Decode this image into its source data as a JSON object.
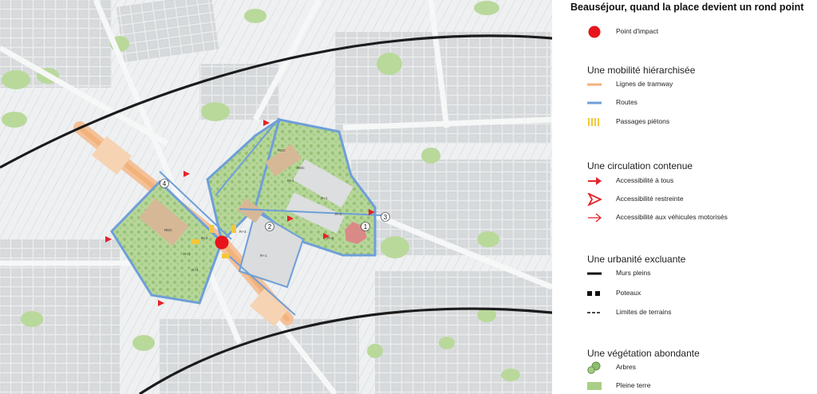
{
  "legend": {
    "title": "Beauséjour, quand la place devient un rond point",
    "impact_label": "Point d'impact",
    "sections": [
      {
        "heading": "Une mobilité hiérarchisée",
        "items": [
          {
            "label": "Lignes de tramway",
            "symbol": "tram-line-icon"
          },
          {
            "label": "Routes",
            "symbol": "road-line-icon"
          },
          {
            "label": "Passages piétons",
            "symbol": "crosswalk-icon"
          }
        ]
      },
      {
        "heading": "Une circulation contenue",
        "items": [
          {
            "label": "Accessibilité à tous",
            "symbol": "full-access-arrow-icon"
          },
          {
            "label": "Accessibilité restreinte",
            "symbol": "restricted-access-arrow-icon"
          },
          {
            "label": "Accessibilité aux véhicules motorisés",
            "symbol": "vehicle-access-arrow-icon"
          }
        ]
      },
      {
        "heading": "Une urbanité excluante",
        "items": [
          {
            "label": "Murs pleins",
            "symbol": "solid-wall-icon"
          },
          {
            "label": "Poteaux",
            "symbol": "posts-icon"
          },
          {
            "label": "Limites de terrains",
            "symbol": "property-limit-icon"
          }
        ]
      },
      {
        "heading": "Une végétation abondante",
        "items": [
          {
            "label": "Arbres",
            "symbol": "tree-icon"
          },
          {
            "label": "Pleine terre",
            "symbol": "open-ground-icon"
          }
        ]
      }
    ]
  },
  "map": {
    "block_numbers": [
      "1",
      "2",
      "3",
      "4"
    ],
    "building_labels": [
      "RDC",
      "RDC",
      "RDC",
      "R+1",
      "R+2",
      "R+3",
      "R+1",
      "R+2",
      "R+1",
      "R+3",
      "R+1",
      "R+2"
    ]
  },
  "colors": {
    "impact": "#e8141b",
    "tram": "#f2b27a",
    "road": "#6e9fd8",
    "crosswalk": "#f2c73a",
    "arrow": "#e5232a",
    "green": "#a9cf86",
    "building": "#d8dadb"
  }
}
